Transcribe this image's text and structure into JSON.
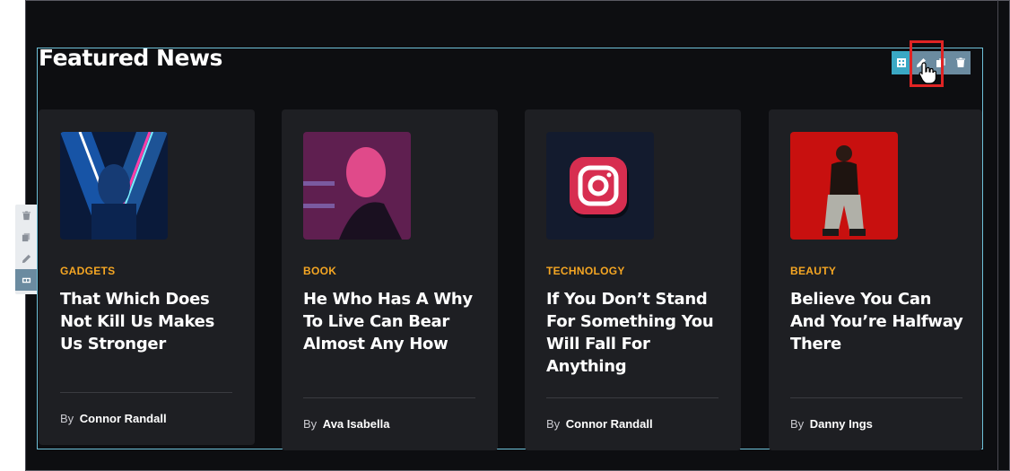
{
  "section": {
    "heading": "Featured News"
  },
  "toolbar": {
    "items": [
      {
        "icon": "element-icon"
      },
      {
        "icon": "pencil-icon"
      },
      {
        "icon": "copy-icon"
      },
      {
        "icon": "trash-icon"
      }
    ]
  },
  "side_tools": {
    "items": [
      {
        "icon": "trash-icon"
      },
      {
        "icon": "copy-icon"
      },
      {
        "icon": "pencil-icon"
      },
      {
        "icon": "column-icon"
      }
    ]
  },
  "byline_prefix": "By",
  "cards": [
    {
      "category": "GADGETS",
      "title": "That Which Does Not Kill Us Makes Us Stronger",
      "author": "Connor Randall",
      "image": "neon-portrait"
    },
    {
      "category": "BOOK",
      "title": "He Who Has A Why To Live Can Bear Almost Any How",
      "author": "Ava Isabella",
      "image": "pink-light-woman"
    },
    {
      "category": "TECHNOLOGY",
      "title": "If You Don’t Stand For Something You Will Fall For Anything",
      "author": "Connor Randall",
      "image": "instagram-logo"
    },
    {
      "category": "BEAUTY",
      "title": "Believe You Can And You’re Halfway There",
      "author": "Danny Ings",
      "image": "red-background-model"
    }
  ],
  "colors": {
    "accent": "#f5a623",
    "section_border": "#6ec1d9",
    "highlight": "#e02424",
    "card_bg": "#1e1f23"
  }
}
